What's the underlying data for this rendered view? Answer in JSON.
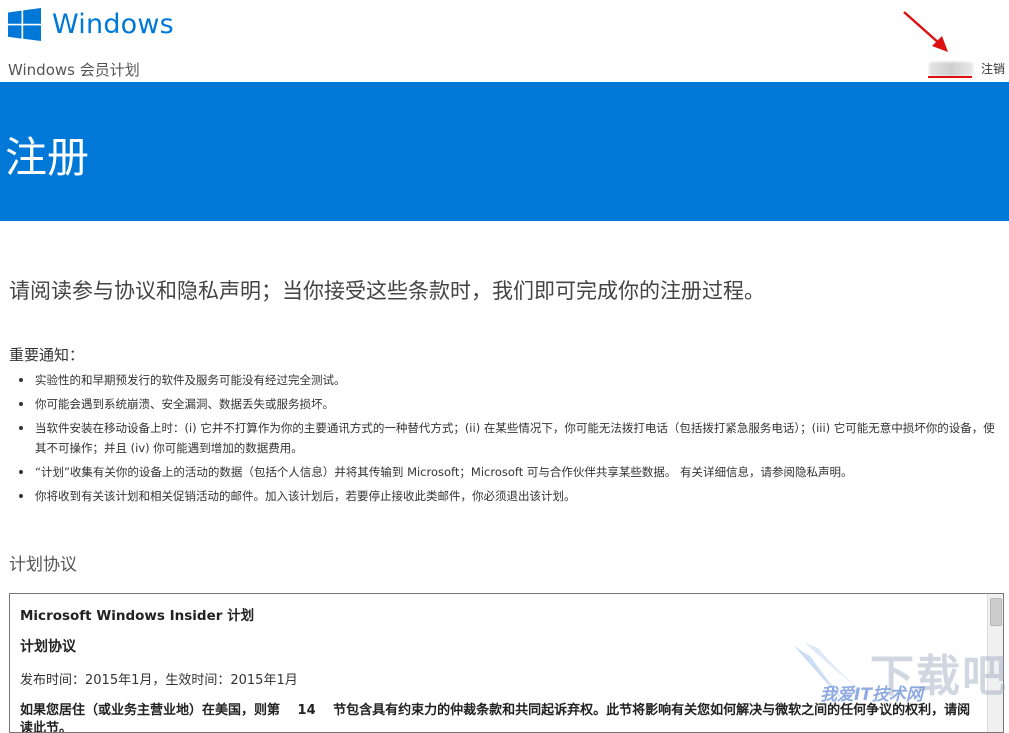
{
  "header": {
    "logo_text": "Windows",
    "subtitle": "Windows 会员计划",
    "signout_label": "注销"
  },
  "banner": {
    "title": "注册"
  },
  "intro": "请阅读参与协议和隐私声明；当你接受这些条款时，我们即可完成你的注册过程。",
  "notice": {
    "title": "重要通知：",
    "items": [
      "实验性的和早期预发行的软件及服务可能没有经过完全测试。",
      "你可能会遇到系统崩溃、安全漏洞、数据丢失或服务损坏。",
      "当软件安装在移动设备上时：(i) 它并不打算作为你的主要通讯方式的一种替代方式；(ii) 在某些情况下，你可能无法拨打电话（包括拨打紧急服务电话）；(iii) 它可能无意中损坏你的设备，使其不可操作；并且 (iv) 你可能遇到增加的数据费用。",
      "“计划”收集有关你的设备上的活动的数据（包括个人信息）并将其传输到 Microsoft；Microsoft 可与合作伙伴共享某些数据。 有关详细信息，请参阅隐私声明。",
      "你将收到有关该计划和相关促销活动的邮件。加入该计划后，若要停止接收此类邮件，你必须退出该计划。"
    ]
  },
  "agreement": {
    "title": "计划协议",
    "heading": "Microsoft Windows Insider 计划",
    "subheading": "计划协议",
    "date": "发布时间：2015年1月，生效时间：2015年1月",
    "paragraph": "如果您居住（或业务主营业地）在美国，则第　 14　 节包含具有约束力的仲裁条款和共同起诉弃权。此节将影响有关您如何解决与微软之间的任何争议的权利，请阅读此节。"
  },
  "watermark": {
    "text": "我爱IT技术网",
    "big_text": "下载吧"
  },
  "colors": {
    "accent": "#0078d7",
    "annotation": "#dd1111"
  }
}
